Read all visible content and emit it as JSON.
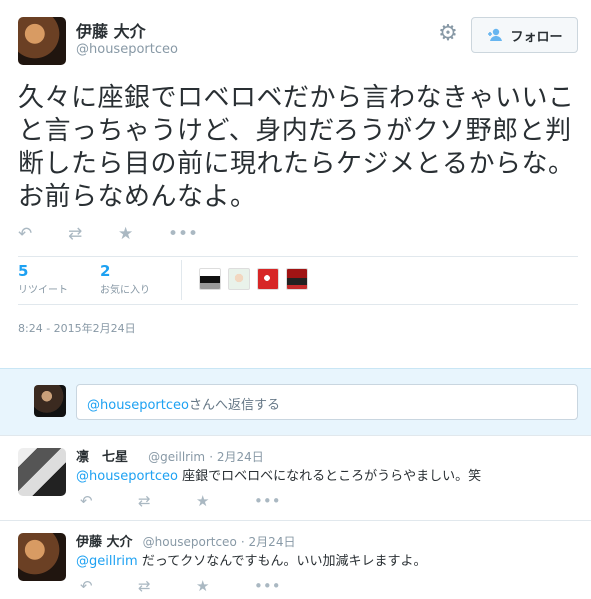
{
  "tweet": {
    "display_name": "伊藤 大介",
    "screen_name": "@houseportceo",
    "text": "久々に座銀でロベロベだから言わなきゃいいこと言っちゃうけど、身内だろうがクソ野郎と判断したら目の前に現れたらケジメとるからな。お前らなめんなよ。",
    "follow_label": "フォロー",
    "retweets_count": "5",
    "retweets_label": "リツイート",
    "likes_count": "2",
    "likes_label": "お気に入り",
    "timestamp": "8:24 - 2015年2月24日"
  },
  "reply_box": {
    "mention": "@houseportceo",
    "suffix": "さんへ返信する"
  },
  "replies": [
    {
      "name": "凛　七星",
      "screen_name": "@geillrim",
      "date": "· 2月24日",
      "mention": "@houseportceo",
      "text": " 座銀でロベロベになれるところがうらやましい。笑"
    },
    {
      "name": "伊藤 大介",
      "screen_name": "@houseportceo",
      "date": "· 2月24日",
      "mention": "@geillrim",
      "text": " だってクソなんですもん。いい加減キレますよ。"
    }
  ],
  "icons": {
    "reply": "reply-icon",
    "retweet": "retweet-icon",
    "favorite": "star-icon",
    "more": "more-icon",
    "settings": "gear-icon",
    "follow": "add-user-icon"
  },
  "colors": {
    "accent": "#1da1f2",
    "muted": "#8899a6",
    "reply_bg": "#e8f5fd"
  }
}
